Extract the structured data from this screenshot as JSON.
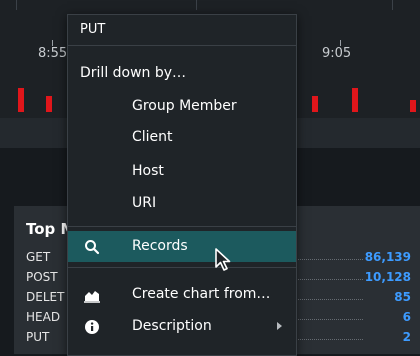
{
  "timeline": {
    "ticks": [
      "8:55",
      "9:05"
    ]
  },
  "panel": {
    "title": "Top M",
    "rows": [
      {
        "method": "GET",
        "value": "86,139"
      },
      {
        "method": "POST",
        "value": "10,128"
      },
      {
        "method": "DELET",
        "value": "85"
      },
      {
        "method": "HEAD",
        "value": "6"
      },
      {
        "method": "PUT",
        "value": "2"
      }
    ]
  },
  "menu": {
    "header": "PUT",
    "drill_title": "Drill down by…",
    "drill_items": [
      "Group Member",
      "Client",
      "Host",
      "URI"
    ],
    "records": "Records",
    "create_chart": "Create chart from…",
    "description": "Description"
  },
  "colors": {
    "accent": "#3d9bff",
    "bar": "#e0161b",
    "active": "#1c5a5e"
  }
}
